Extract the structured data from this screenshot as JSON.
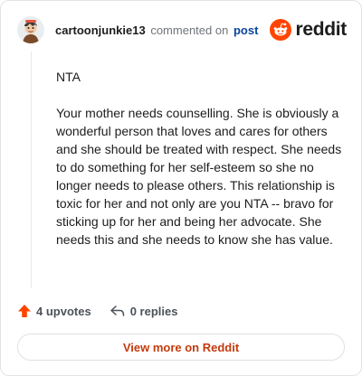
{
  "comment": {
    "username": "cartoonjunkie13",
    "commented_text": "commented on",
    "post_link": "post",
    "paragraphs": [
      "NTA",
      "Your mother needs counselling. She is obviously a wonderful person that loves and cares for others and she should be treated with respect. She needs to do something for her self-esteem so she no longer needs to please others. This relationship is toxic for her and not only are you NTA -- bravo for sticking up for her and being her advocate. She needs this and she needs to know she has value."
    ]
  },
  "brand": {
    "name": "reddit",
    "color": "#ff4500"
  },
  "actions": {
    "upvotes": "4 upvotes",
    "replies": "0 replies"
  },
  "footer": {
    "view_more": "View more on Reddit"
  },
  "icons": {
    "avatar": "cartoon-avatar",
    "logo": "reddit-snoo-icon",
    "upvote": "upvote-arrow-icon",
    "reply": "reply-arrow-icon"
  }
}
